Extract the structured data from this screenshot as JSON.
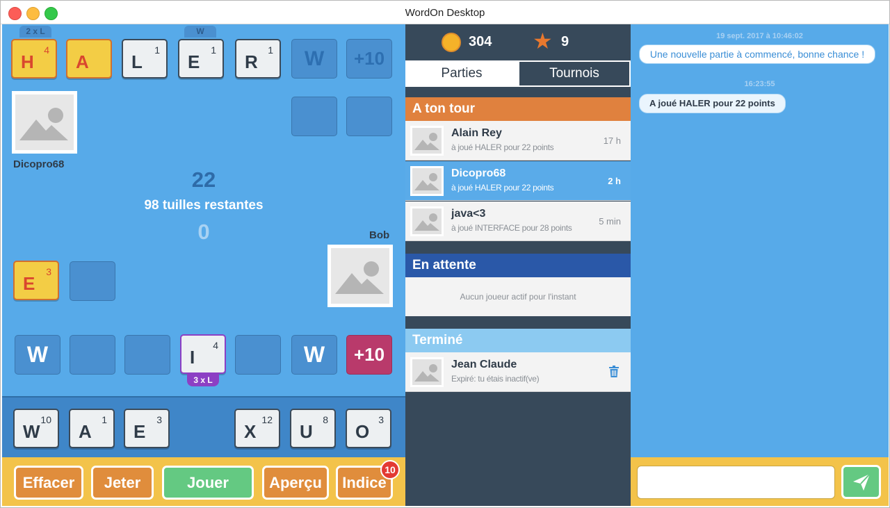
{
  "window": {
    "title": "WordOn Desktop"
  },
  "board": {
    "top_row": [
      {
        "letter": "H",
        "score": "4",
        "style": "gold"
      },
      {
        "letter": "A",
        "score": "",
        "style": "gold"
      },
      {
        "letter": "L",
        "score": "1",
        "style": "normal"
      },
      {
        "letter": "E",
        "score": "1",
        "style": "normal"
      },
      {
        "letter": "R",
        "score": "1",
        "style": "normal"
      }
    ],
    "top_tags": [
      "2 x L",
      "W"
    ],
    "top_bonus": [
      "W",
      "+10"
    ],
    "opponent": {
      "name": "Dicopro68"
    },
    "player": {
      "name": "Bob"
    },
    "score_opponent": "22",
    "tiles_remaining": "98 tuilles restantes",
    "score_player": "0",
    "mid_tile": {
      "letter": "E",
      "score": "3"
    },
    "bottom_row": {
      "w_left": "W",
      "active_tile": {
        "letter": "I",
        "score": "4"
      },
      "active_tag": "3 x L",
      "w_right": "W",
      "plus10": "+10"
    }
  },
  "rack": [
    {
      "letter": "W",
      "score": "10"
    },
    {
      "letter": "A",
      "score": "1"
    },
    {
      "letter": "E",
      "score": "3"
    },
    {
      "letter": "X",
      "score": "12"
    },
    {
      "letter": "U",
      "score": "8"
    },
    {
      "letter": "O",
      "score": "3"
    }
  ],
  "actions": {
    "clear": "Effacer",
    "discard": "Jeter",
    "play": "Jouer",
    "preview": "Aperçu",
    "hint": "Indice",
    "hint_count": "10"
  },
  "stats": {
    "coins": "304",
    "stars": "9",
    "star_icon": "★"
  },
  "tabs": {
    "games": "Parties",
    "tournaments": "Tournois"
  },
  "sections": {
    "your_turn": "A ton tour",
    "waiting": "En attente",
    "finished": "Terminé",
    "waiting_empty": "Aucun joueur actif pour l'instant"
  },
  "games_your_turn": [
    {
      "name": "Alain Rey",
      "sub": "à joué HALER pour 22 points",
      "time": "17 h"
    },
    {
      "name": "Dicopro68",
      "sub": "à joué HALER pour 22 points",
      "time": "2 h"
    },
    {
      "name": "java<3",
      "sub": "à joué INTERFACE pour 28 points",
      "time": "5 min"
    }
  ],
  "games_finished": [
    {
      "name": "Jean Claude",
      "sub": "Expiré: tu étais inactif(ve)"
    }
  ],
  "chat": {
    "time1": "19 sept. 2017 à 10:46:02",
    "msg1": "Une nouvelle partie à commencé, bonne chance !",
    "time2": "16:23:55",
    "msg2": "A joué HALER pour 22 points",
    "input_value": ""
  },
  "colors": {
    "board_blue": "#57aae9",
    "panel_dark": "#37495a",
    "accent_orange": "#e08d3c",
    "accent_green": "#64c982",
    "tile_gold": "#f3cd45"
  }
}
